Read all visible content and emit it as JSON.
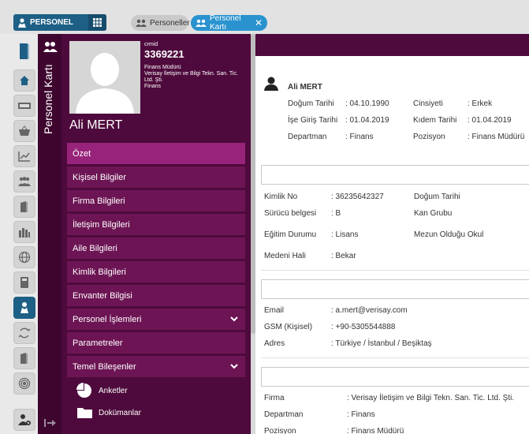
{
  "header": {
    "brand": "PERSONEL",
    "tabs": [
      {
        "label": "Personeller"
      },
      {
        "label": "Personel Kartı"
      }
    ]
  },
  "sidebar_title": "Personel Kartı",
  "user": {
    "id_label": "crmid",
    "id": "3369221",
    "role": "Finans Müdürü",
    "company": "Verisay İletişim ve Bilgi Tekn. San. Tic. Ltd. Şti.",
    "department": "Finans",
    "name": "Ali MERT"
  },
  "menu": [
    {
      "label": "Özet"
    },
    {
      "label": "Kişisel Bilgiler"
    },
    {
      "label": "Firma Bilgileri"
    },
    {
      "label": "İletişim Bilgileri"
    },
    {
      "label": "Aile Bilgileri"
    },
    {
      "label": "Kimlik Bilgileri"
    },
    {
      "label": "Envanter Bilgisi"
    },
    {
      "label": "Personel İşlemleri"
    },
    {
      "label": "Parametreler"
    },
    {
      "label": "Temel Bileşenler"
    }
  ],
  "submenu": [
    {
      "label": "Anketler"
    },
    {
      "label": "Dokümanlar"
    }
  ],
  "summary": {
    "name": "Ali MERT",
    "rows": [
      {
        "k1": "Doğum Tarihi",
        "v1": ": 04.10.1990",
        "k2": "Cinsiyeti",
        "v2": ": Erkek"
      },
      {
        "k1": "İşe Giriş Tarihi",
        "v1": ": 01.04.2019",
        "k2": "Kıdem Tarihi",
        "v2": ": 01.04.2019"
      },
      {
        "k1": "Departman",
        "v1": ": Finans",
        "k2": "Pozisyon",
        "v2": ": Finans Müdürü"
      }
    ]
  },
  "personal": [
    {
      "k": "Kimlik No",
      "v": ": 36235642327",
      "k2": "Doğum Tarihi"
    },
    {
      "k": "Sürücü belgesi",
      "v": ": B",
      "k2": "Kan Grubu"
    },
    {
      "k": "Eğitim Durumu",
      "v": ": Lisans",
      "k2": "Mezun Olduğu Okul"
    },
    {
      "k": "Medeni Hali",
      "v": ": Bekar",
      "k2": ""
    }
  ],
  "contact": [
    {
      "k": "Email",
      "v": ": a.mert@verisay.com"
    },
    {
      "k": "GSM (Kişisel)",
      "v": ": +90-5305544888"
    },
    {
      "k": "Adres",
      "v": ": Türkiye / İstanbul / Beşiktaş"
    }
  ],
  "company": [
    {
      "k": "Firma",
      "v": ": Verisay İletişim ve Bilgi Tekn. San. Tic. Ltd. Şti."
    },
    {
      "k": "Departman",
      "v": ": Finans"
    },
    {
      "k": "Pozisyon",
      "v": ": Finans Müdürü"
    }
  ]
}
